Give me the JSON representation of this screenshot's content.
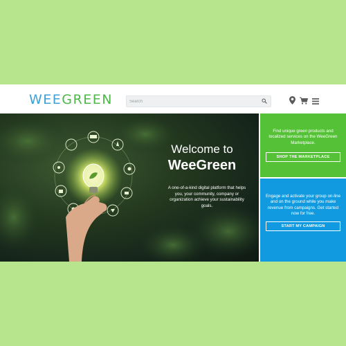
{
  "header": {
    "logo": {
      "wee": "WEE",
      "green": "GREEN"
    },
    "search": {
      "placeholder": "Search"
    }
  },
  "hero": {
    "title_line1": "Welcome to",
    "title_line2": "WeeGreen",
    "description": "A one-of-a-kind digital platform that helps you, your community, company or organization achieve your sustainability goals."
  },
  "marketplace_panel": {
    "text": "Find unique green products and localized services on the WeeGreen Marketplace.",
    "button_label": "SHOP THE MARKETPLACE",
    "color": "#55c137"
  },
  "campaign_panel": {
    "text": "Engage and activate your group on-line and on the ground while you make revenue from campaigns. Get started now for free.",
    "button_label": "START MY CAMPAIGN",
    "color": "#119ae0"
  },
  "colors": {
    "page_background": "#b6e58d",
    "brand_blue": "#3da0d6",
    "brand_green": "#4db848"
  },
  "icons": [
    "logo-people-icon",
    "search-icon",
    "location-pin-icon",
    "cart-icon",
    "menu-icon"
  ]
}
